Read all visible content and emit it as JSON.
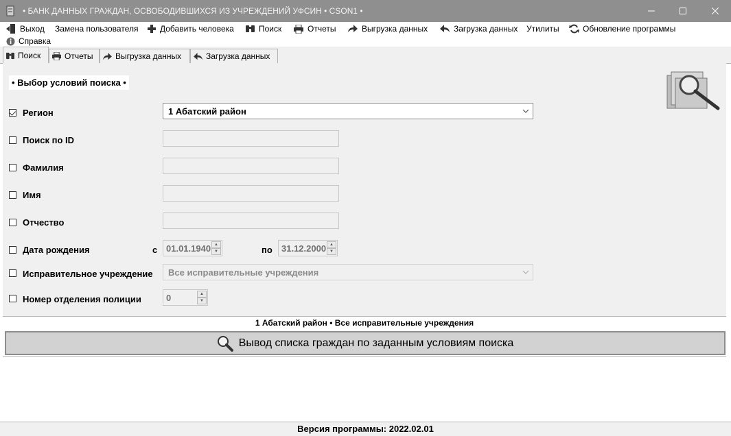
{
  "window": {
    "title": "• БАНК ДАННЫХ ГРАЖДАН, ОСВОБОДИВШИХСЯ ИЗ УЧРЕЖДЕНИЙ УФСИН • CSON1 •",
    "minimize_icon": "minimize-icon",
    "maximize_icon": "maximize-icon",
    "close_icon": "close-icon"
  },
  "menu": {
    "exit": "Выход",
    "change_user": "Замена пользователя",
    "add_person": "Добавить человека",
    "search": "Поиск",
    "reports": "Отчеты",
    "export": "Выгрузка данных",
    "import": "Загрузка данных",
    "utilities": "Утилиты",
    "update": "Обновление программы",
    "help": "Справка"
  },
  "tabs": [
    {
      "label": "Поиск",
      "icon": "binoculars-icon",
      "active": true
    },
    {
      "label": "Отчеты",
      "icon": "printer-icon",
      "active": false
    },
    {
      "label": "Выгрузка данных",
      "icon": "arrow-forward-icon",
      "active": false
    },
    {
      "label": "Загрузка данных",
      "icon": "arrow-back-icon",
      "active": false
    }
  ],
  "search_panel": {
    "group_title": "• Выбор условий поиска •",
    "region": {
      "label": "Регион",
      "checked": true,
      "value": "1   Абатский район"
    },
    "id": {
      "label": "Поиск по ID",
      "checked": false,
      "value": ""
    },
    "surname": {
      "label": "Фамилия",
      "checked": false,
      "value": ""
    },
    "name": {
      "label": "Имя",
      "checked": false,
      "value": ""
    },
    "patronymic": {
      "label": "Отчество",
      "checked": false,
      "value": ""
    },
    "birth_date": {
      "label": "Дата рождения",
      "checked": false,
      "from_label": "с",
      "from": "01.01.1940",
      "to_label": "по",
      "to": "31.12.2000"
    },
    "institution": {
      "label": "Исправительное учреждение",
      "checked": false,
      "value": "Все исправительные учреждения"
    },
    "police_unit": {
      "label": "Номер отделения полиции",
      "checked": false,
      "value": "0"
    }
  },
  "summary": "1   Абатский район • Все исправительные учреждения",
  "search_button": "Вывод списка граждан по заданным условиям поиска",
  "status": "Версия программы: 2022.02.01",
  "colors": {
    "titlebar": "#8f8f8f",
    "panel": "#f0f0f0",
    "button": "#d2d2d2"
  }
}
